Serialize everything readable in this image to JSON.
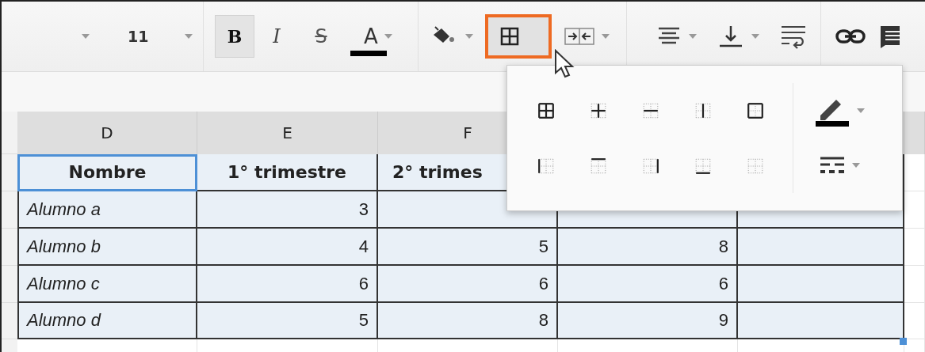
{
  "toolbar": {
    "buttons": [
      {
        "kind": "font",
        "active": false
      },
      {
        "kind": "size",
        "label": "11",
        "active": false
      },
      {
        "kind": "bold",
        "label": "B",
        "active": true
      },
      {
        "kind": "italic",
        "label": "I",
        "active": false
      },
      {
        "kind": "strike",
        "label": "S",
        "active": false
      },
      {
        "kind": "textcolor",
        "label": "A",
        "active": false
      },
      {
        "kind": "fill",
        "active": false
      },
      {
        "kind": "borders",
        "active": true
      },
      {
        "kind": "merge",
        "active": false
      },
      {
        "kind": "align",
        "active": false
      },
      {
        "kind": "valign",
        "active": false
      },
      {
        "kind": "wrap",
        "active": false
      },
      {
        "kind": "link",
        "active": false
      },
      {
        "kind": "comment",
        "active": false
      }
    ]
  },
  "sheet": {
    "columns": [
      "D",
      "E",
      "F"
    ],
    "header_row": [
      {
        "text": "Nombre",
        "selected": true
      },
      {
        "text": "1° trimestre",
        "selected": false
      },
      {
        "text": "2° trimes",
        "selected": false
      }
    ],
    "rows": [
      {
        "name": "Alumno a",
        "values": [
          "3"
        ]
      },
      {
        "name": "Alumno b",
        "values": [
          "4",
          "5",
          "8"
        ]
      },
      {
        "name": "Alumno c",
        "values": [
          "6",
          "6",
          "6"
        ]
      },
      {
        "name": "Alumno d",
        "values": [
          "5",
          "8",
          "9"
        ]
      }
    ]
  },
  "borders_menu": {
    "options": [
      {
        "kind": "all"
      },
      {
        "kind": "inner"
      },
      {
        "kind": "horizontal"
      },
      {
        "kind": "vertical"
      },
      {
        "kind": "outer"
      },
      {
        "kind": "left"
      },
      {
        "kind": "top"
      },
      {
        "kind": "right"
      },
      {
        "kind": "bottom"
      },
      {
        "kind": "none"
      }
    ],
    "tools": [
      {
        "kind": "color"
      },
      {
        "kind": "style"
      }
    ]
  }
}
